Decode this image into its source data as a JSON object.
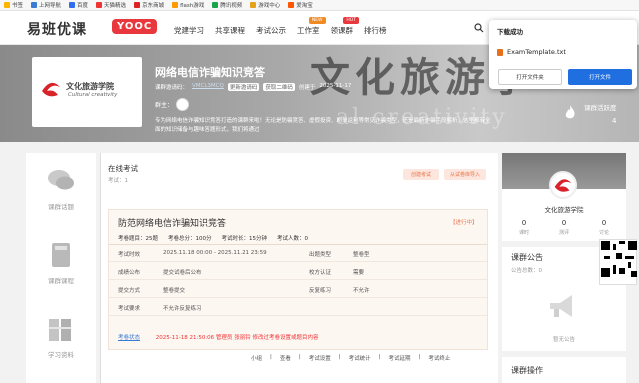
{
  "bookmarks": [
    "书签",
    "上网导航",
    "百度",
    "天猫精选",
    "京东商城",
    "flash游戏",
    "腾讯视频",
    "游戏中心",
    "爱淘宝"
  ],
  "nav": {
    "logo": "易班优课",
    "yooc": "YOOC",
    "menu": [
      "党建学习",
      "共享课程",
      "考试公示",
      "工作室",
      "领课群",
      "排行榜"
    ],
    "badges": {
      "new": "NEW",
      "hot": "HOT"
    }
  },
  "hero": {
    "title": "网络电信诈骗知识竞答",
    "logo_cn": "文化旅游学院",
    "logo_en": "Cultural creativity",
    "watermark": "文化旅游学",
    "watermark2": "al creativity",
    "meta_label": "课群邀请码：",
    "meta_code": "VMCL3MCQ",
    "meta_btn1": "更新邀请码",
    "meta_btn2": "获取二维码",
    "meta_date_label": "创建于",
    "meta_date": "2025-11-17",
    "owner_label": "群主：",
    "desc": "专为网络电信诈骗知识竞答打造的课群来啦！无论是防骗竞答、虚假投资、刷单返利等常见诈骗类型，还是最新诈骗手段解析，这里都有全面的知识储备与趣味答题形式，我们将通过",
    "activity_label": "课群活跃度",
    "activity": "4"
  },
  "download": {
    "title": "下载成功",
    "file": "ExamTemplate.txt",
    "open_folder": "打开文件夹",
    "open_file": "打开文件"
  },
  "sidebar": [
    "课群话题",
    "课群课程",
    "学习资料"
  ],
  "main": {
    "title": "在线考试",
    "subtitle": "考试：1",
    "btn_create": "创建考试",
    "btn_import": "从试卷库导入",
    "exam": {
      "name": "防范网络电信诈骗知识竞答",
      "status": "【进行中】",
      "stats": [
        "考卷题目：25题",
        "考卷总分：100分",
        "考试时长：15分钟",
        "考试人数：0"
      ],
      "rows": [
        {
          "k1": "考试时效",
          "v1": "2025.11.18 00:00 - 2025.11.21 23:59",
          "k2": "出题类型",
          "v2": "整卷型"
        },
        {
          "k1": "成绩公布",
          "v1": "提交试卷后公布",
          "k2": "校方认证",
          "v2": "需要"
        },
        {
          "k1": "提交方式",
          "v1": "整卷提交",
          "k2": "反复练习",
          "v2": "不允许"
        },
        {
          "k1": "考试要求",
          "v1": "不允许反复练习",
          "k2": "",
          "v2": ""
        }
      ],
      "status_label": "考卷状态",
      "status_time": "2025-11-18 21:50:06 管理员",
      "status_user": "张丽铃",
      "status_text": "修改过考卷设置或题目内容"
    },
    "actions": [
      "小组",
      "查看",
      "考试设置",
      "考试统计",
      "考试延期",
      "考试终止"
    ]
  },
  "right": {
    "group_name": "文化旅游学院",
    "stats": [
      {
        "n": "0",
        "l": "课时"
      },
      {
        "n": "0",
        "l": "测评"
      },
      {
        "n": "0",
        "l": "讨论"
      }
    ],
    "notice_title": "课群公告",
    "notice_count": "公告总数：0",
    "notice_empty": "暂无公告",
    "ops_title": "课群操作"
  }
}
